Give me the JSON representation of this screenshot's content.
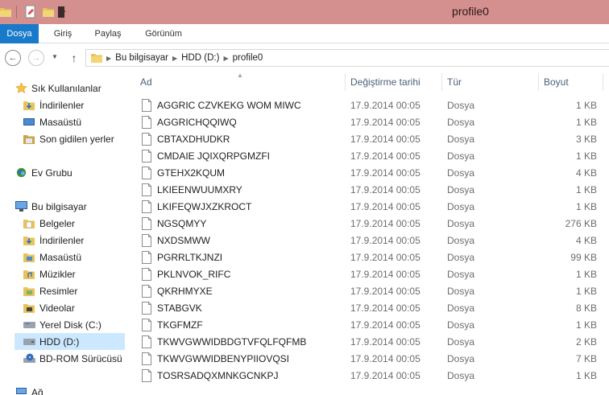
{
  "window": {
    "title": "profile0"
  },
  "ribbon": {
    "tabs": [
      "Dosya",
      "Giriş",
      "Paylaş",
      "Görünüm"
    ]
  },
  "address": {
    "crumbs": [
      "Bu bilgisayar",
      "HDD (D:)",
      "profile0"
    ]
  },
  "navpane": {
    "favorites_label": "Sık Kullanılanlar",
    "favorites": [
      "İndirilenler",
      "Masaüstü",
      "Son gidilen yerler"
    ],
    "homegroup_label": "Ev Grubu",
    "thispc_label": "Bu bilgisayar",
    "thispc_items": [
      "Belgeler",
      "İndirilenler",
      "Masaüstü",
      "Müzikler",
      "Resimler",
      "Videolar",
      "Yerel Disk (C:)",
      "HDD (D:)",
      "BD-ROM Sürücüsü ("
    ],
    "network_label": "Ağ"
  },
  "columns": {
    "name": "Ad",
    "date": "Değiştirme tarihi",
    "type": "Tür",
    "size": "Boyut"
  },
  "files": [
    {
      "name": "AGGRIC CZVKEKG WOM MIWC",
      "date": "17.9.2014 00:05",
      "type": "Dosya",
      "size": "1 KB"
    },
    {
      "name": "AGGRICHQQIWQ",
      "date": "17.9.2014 00:05",
      "type": "Dosya",
      "size": "1 KB"
    },
    {
      "name": "CBTAXDHUDKR",
      "date": "17.9.2014 00:05",
      "type": "Dosya",
      "size": "3 KB"
    },
    {
      "name": "CMDAIE JQIXQRPGMZFI",
      "date": "17.9.2014 00:05",
      "type": "Dosya",
      "size": "1 KB"
    },
    {
      "name": "GTEHX2KQUM",
      "date": "17.9.2014 00:05",
      "type": "Dosya",
      "size": "4 KB"
    },
    {
      "name": "LKIEENWUUMXRY",
      "date": "17.9.2014 00:05",
      "type": "Dosya",
      "size": "1 KB"
    },
    {
      "name": "LKIFEQWJXZKROCT",
      "date": "17.9.2014 00:05",
      "type": "Dosya",
      "size": "1 KB"
    },
    {
      "name": "NGSQMYY",
      "date": "17.9.2014 00:05",
      "type": "Dosya",
      "size": "276 KB"
    },
    {
      "name": "NXDSMWW",
      "date": "17.9.2014 00:05",
      "type": "Dosya",
      "size": "4 KB"
    },
    {
      "name": "PGRRLTKJNZI",
      "date": "17.9.2014 00:05",
      "type": "Dosya",
      "size": "99 KB"
    },
    {
      "name": "PKLNVOK_RIFC",
      "date": "17.9.2014 00:05",
      "type": "Dosya",
      "size": "1 KB"
    },
    {
      "name": "QKRHMYXE",
      "date": "17.9.2014 00:05",
      "type": "Dosya",
      "size": "1 KB"
    },
    {
      "name": "STABGVK",
      "date": "17.9.2014 00:05",
      "type": "Dosya",
      "size": "8 KB"
    },
    {
      "name": "TKGFMZF",
      "date": "17.9.2014 00:05",
      "type": "Dosya",
      "size": "1 KB"
    },
    {
      "name": "TKWVGWWIDBDGTVFQLFQFMB",
      "date": "17.9.2014 00:05",
      "type": "Dosya",
      "size": "2 KB"
    },
    {
      "name": "TKWVGWWIDBENYPIIOVQSI",
      "date": "17.9.2014 00:05",
      "type": "Dosya",
      "size": "7 KB"
    },
    {
      "name": "TOSRSADQXMNKGCNKPJ",
      "date": "17.9.2014 00:05",
      "type": "Dosya",
      "size": "1 KB"
    }
  ]
}
